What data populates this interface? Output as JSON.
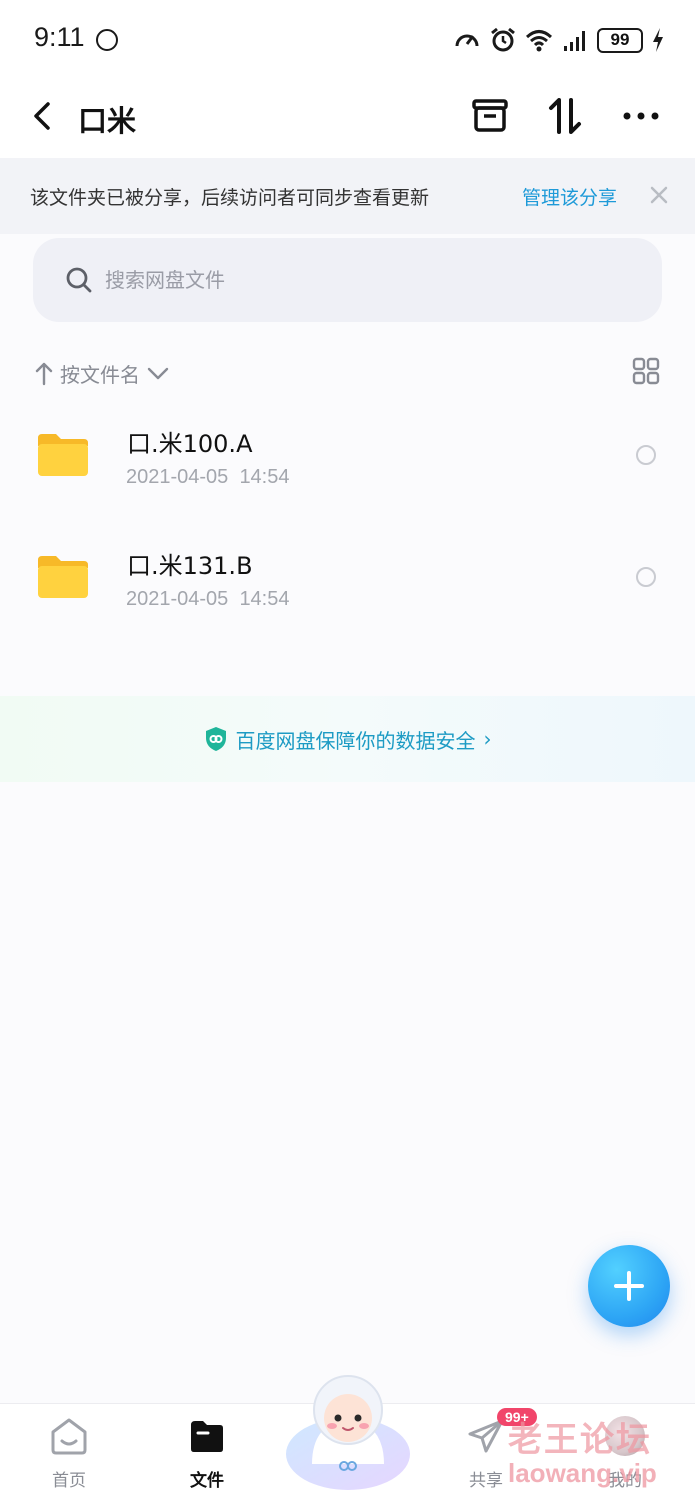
{
  "status_bar": {
    "time": "9:11",
    "battery": "99"
  },
  "header": {
    "title": "口米"
  },
  "share_banner": {
    "text": "该文件夹已被分享，后续访问者可同步查看更新",
    "link": "管理该分享"
  },
  "search": {
    "placeholder": "搜索网盘文件"
  },
  "sort": {
    "label": "按文件名"
  },
  "files": [
    {
      "name": "口.米100.A",
      "date": "2021-04-05",
      "time": "14:54"
    },
    {
      "name": "口.米131.B",
      "date": "2021-04-05",
      "time": "14:54"
    }
  ],
  "security_banner": {
    "text": "百度网盘保障你的数据安全",
    "chevron": "›"
  },
  "bottom_nav": {
    "home": "首页",
    "files": "文件",
    "share": "共享",
    "share_badge": "99+",
    "mine": "我的"
  },
  "watermark": {
    "text": "老王论坛",
    "sub": "laowang.vip"
  },
  "colors": {
    "accent": "#1e9ad8",
    "fab": "#2ea6f5",
    "badge": "#f1456a",
    "folder": "#ffcc33"
  },
  "icons": {
    "back": "chevron-left-icon",
    "trash": "recycle-bin-icon",
    "sort": "sort-arrows-icon",
    "more": "more-dots-icon",
    "close": "close-icon",
    "search": "search-icon",
    "grid": "grid-view-icon",
    "folder": "folder-icon",
    "shield": "shield-icon",
    "add": "plus-icon"
  }
}
